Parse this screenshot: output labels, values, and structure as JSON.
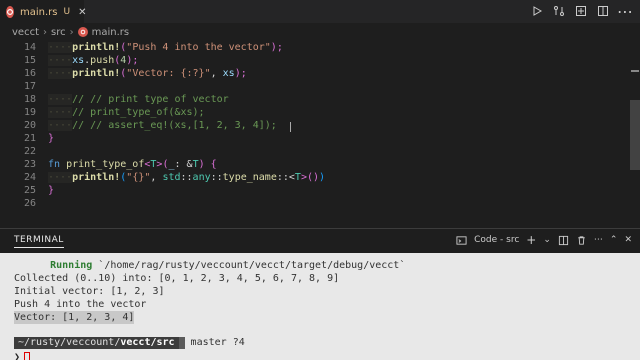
{
  "tab": {
    "filename": "main.rs",
    "status": "U"
  },
  "breadcrumb": [
    "vecct",
    "src",
    "main.rs"
  ],
  "gutter": [
    "14",
    "15",
    "16",
    "17",
    "18",
    "19",
    "20",
    "21",
    "22",
    "23",
    "24",
    "25",
    "26"
  ],
  "panel": {
    "title": "TERMINAL",
    "terminal_name": "Code - src"
  },
  "terminal": {
    "running_label": "Running",
    "running_path": " `/home/rag/rusty/veccount/vecct/target/debug/vecct`",
    "lines": [
      "Collected (0..10) into: [0, 1, 2, 3, 4, 5, 6, 7, 8, 9]",
      "Initial vector: [1, 2, 3]",
      "Push 4 into the vector",
      "Vector: [1, 2, 3, 4]"
    ],
    "prompt_path_prefix": "~/rusty/veccount/",
    "prompt_path_bold": "vecct/src",
    "prompt_git": "master ?4",
    "prompt_symbol": "❯"
  },
  "code": {
    "l14": {
      "mac": "println!",
      "open": "(",
      "str": "\"Push 4 into the vector\"",
      "close": ");"
    },
    "l15": {
      "id": "xs",
      "dot": ".",
      "fn": "push",
      "open": "(",
      "num": "4",
      "close": ");"
    },
    "l16": {
      "mac": "println!",
      "open": "(",
      "str": "\"Vector: {:?}\"",
      "mid": ", ",
      "id": "xs",
      "close": ");"
    },
    "l18": "// // print type of vector",
    "l19": "// print_type_of(&xs);",
    "l20": "// // assert_eq!(xs,[1, 2, 3, 4]);",
    "l21": "}",
    "l23": {
      "kw": "fn",
      "fn": "print_type_of",
      "gen_open": "<",
      "ty": "T",
      "gen_close": ">",
      "p1": "(",
      "pat": "_",
      "colon": ": &",
      "ty2": "T",
      "p2": ") {"
    },
    "l24": {
      "mac": "println!",
      "open": "(",
      "str": "\"{}\"",
      "mid": ", ",
      "ns1": "std",
      "sep1": "::",
      "ns2": "any",
      "sep2": "::",
      "fn": "type_name",
      "turbo": "::<",
      "ty": "T",
      "end": ">()",
      "close": ")"
    },
    "l25": "}"
  },
  "colors": {
    "editor_bg": "#1e1e1e",
    "terminal_bg": "#e8e8e8",
    "rust_icon": "#d8584f",
    "modified": "#e2c08d"
  }
}
